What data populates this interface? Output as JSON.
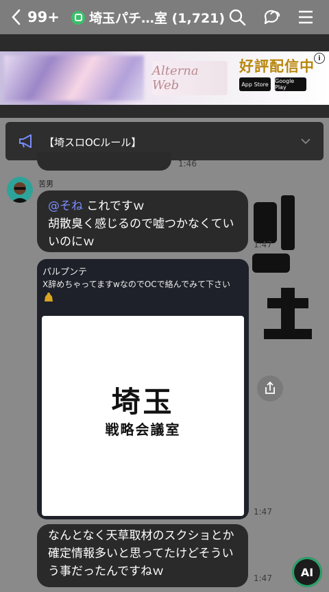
{
  "header": {
    "unread_count": "99+",
    "title": "埼玉パチ…室 (1,721)"
  },
  "ad": {
    "logo_text": "Alterna Web",
    "headline": "好評配信中",
    "store_apple": "App Store",
    "store_google": "Google Play",
    "info_label": "i"
  },
  "notice": {
    "text": "【埼スロOCルール】"
  },
  "messages": [
    {
      "time": "1:46"
    },
    {
      "sender": "苦男",
      "mention": "@そね",
      "text_line1_rest": " これですｗ",
      "text_rest": "胡散臭く感じるので嘘つかなくていいのにｗ",
      "time": "1:47"
    },
    {
      "card_title": "パルプンテ",
      "card_desc": "X辞めちゃってますwなのでOCで絡んでみて下さい",
      "logo_main": "埼玉",
      "logo_sub": "戦略会議室",
      "time": "1:47"
    },
    {
      "text": "なんとなく天草取材のスクショとか確定情報多いと思ってたけどそういう事だったんですねｗ",
      "time": "1:47"
    }
  ],
  "ai_button": "AI"
}
